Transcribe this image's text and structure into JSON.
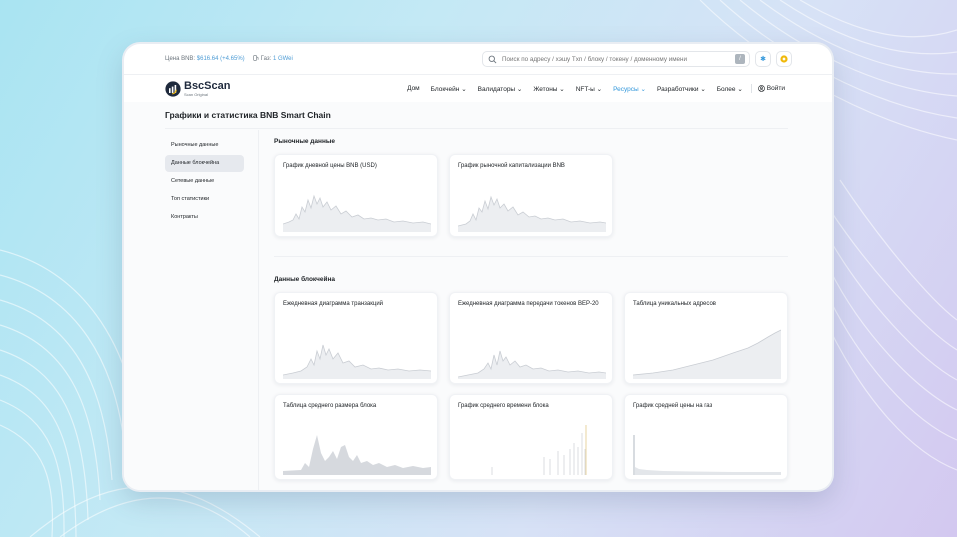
{
  "topbar": {
    "price_label": "Цена BNB:",
    "price_value": "$616.64 (+4.65%)",
    "gas_label": "Газ:",
    "gas_value": "1 GWei",
    "search_placeholder": "Поиск по адресу / хэшу Txn / блоку / токену / доменному имени",
    "slash_key": "/"
  },
  "brand": {
    "name": "BscScan",
    "tagline": "Scan Original"
  },
  "nav": {
    "items": [
      {
        "label": "Дом"
      },
      {
        "label": "Блокчейн ⌄"
      },
      {
        "label": "Валидаторы ⌄"
      },
      {
        "label": "Жетоны ⌄"
      },
      {
        "label": "NFT-ы ⌄"
      },
      {
        "label": "Ресурсы ⌄"
      },
      {
        "label": "Разработчики ⌄"
      },
      {
        "label": "Более ⌄"
      }
    ],
    "login": "Войти",
    "active_color": "#3498db"
  },
  "page": {
    "title": "Графики и статистика BNB Smart Chain"
  },
  "sidebar": {
    "items": [
      {
        "label": "Рыночные данные"
      },
      {
        "label": "Данные блокчейна"
      },
      {
        "label": "Сетевые данные"
      },
      {
        "label": "Топ статистики"
      },
      {
        "label": "Контракты"
      }
    ]
  },
  "sections": {
    "market": {
      "title": "Рыночные данные",
      "cards": [
        {
          "title": "График дневной цены BNB (USD)"
        },
        {
          "title": "График рыночной капитализации BNB"
        }
      ]
    },
    "blockchain": {
      "title": "Данные блокчейна",
      "cards": [
        {
          "title": "Ежедневная диаграмма транзакций"
        },
        {
          "title": "Ежедневная диаграмма передачи токенов BEP-20"
        },
        {
          "title": "Таблица уникальных адресов"
        },
        {
          "title": "Таблица среднего размера блока"
        },
        {
          "title": "График среднего времени блока"
        },
        {
          "title": "График средней цены на газ"
        }
      ]
    }
  }
}
